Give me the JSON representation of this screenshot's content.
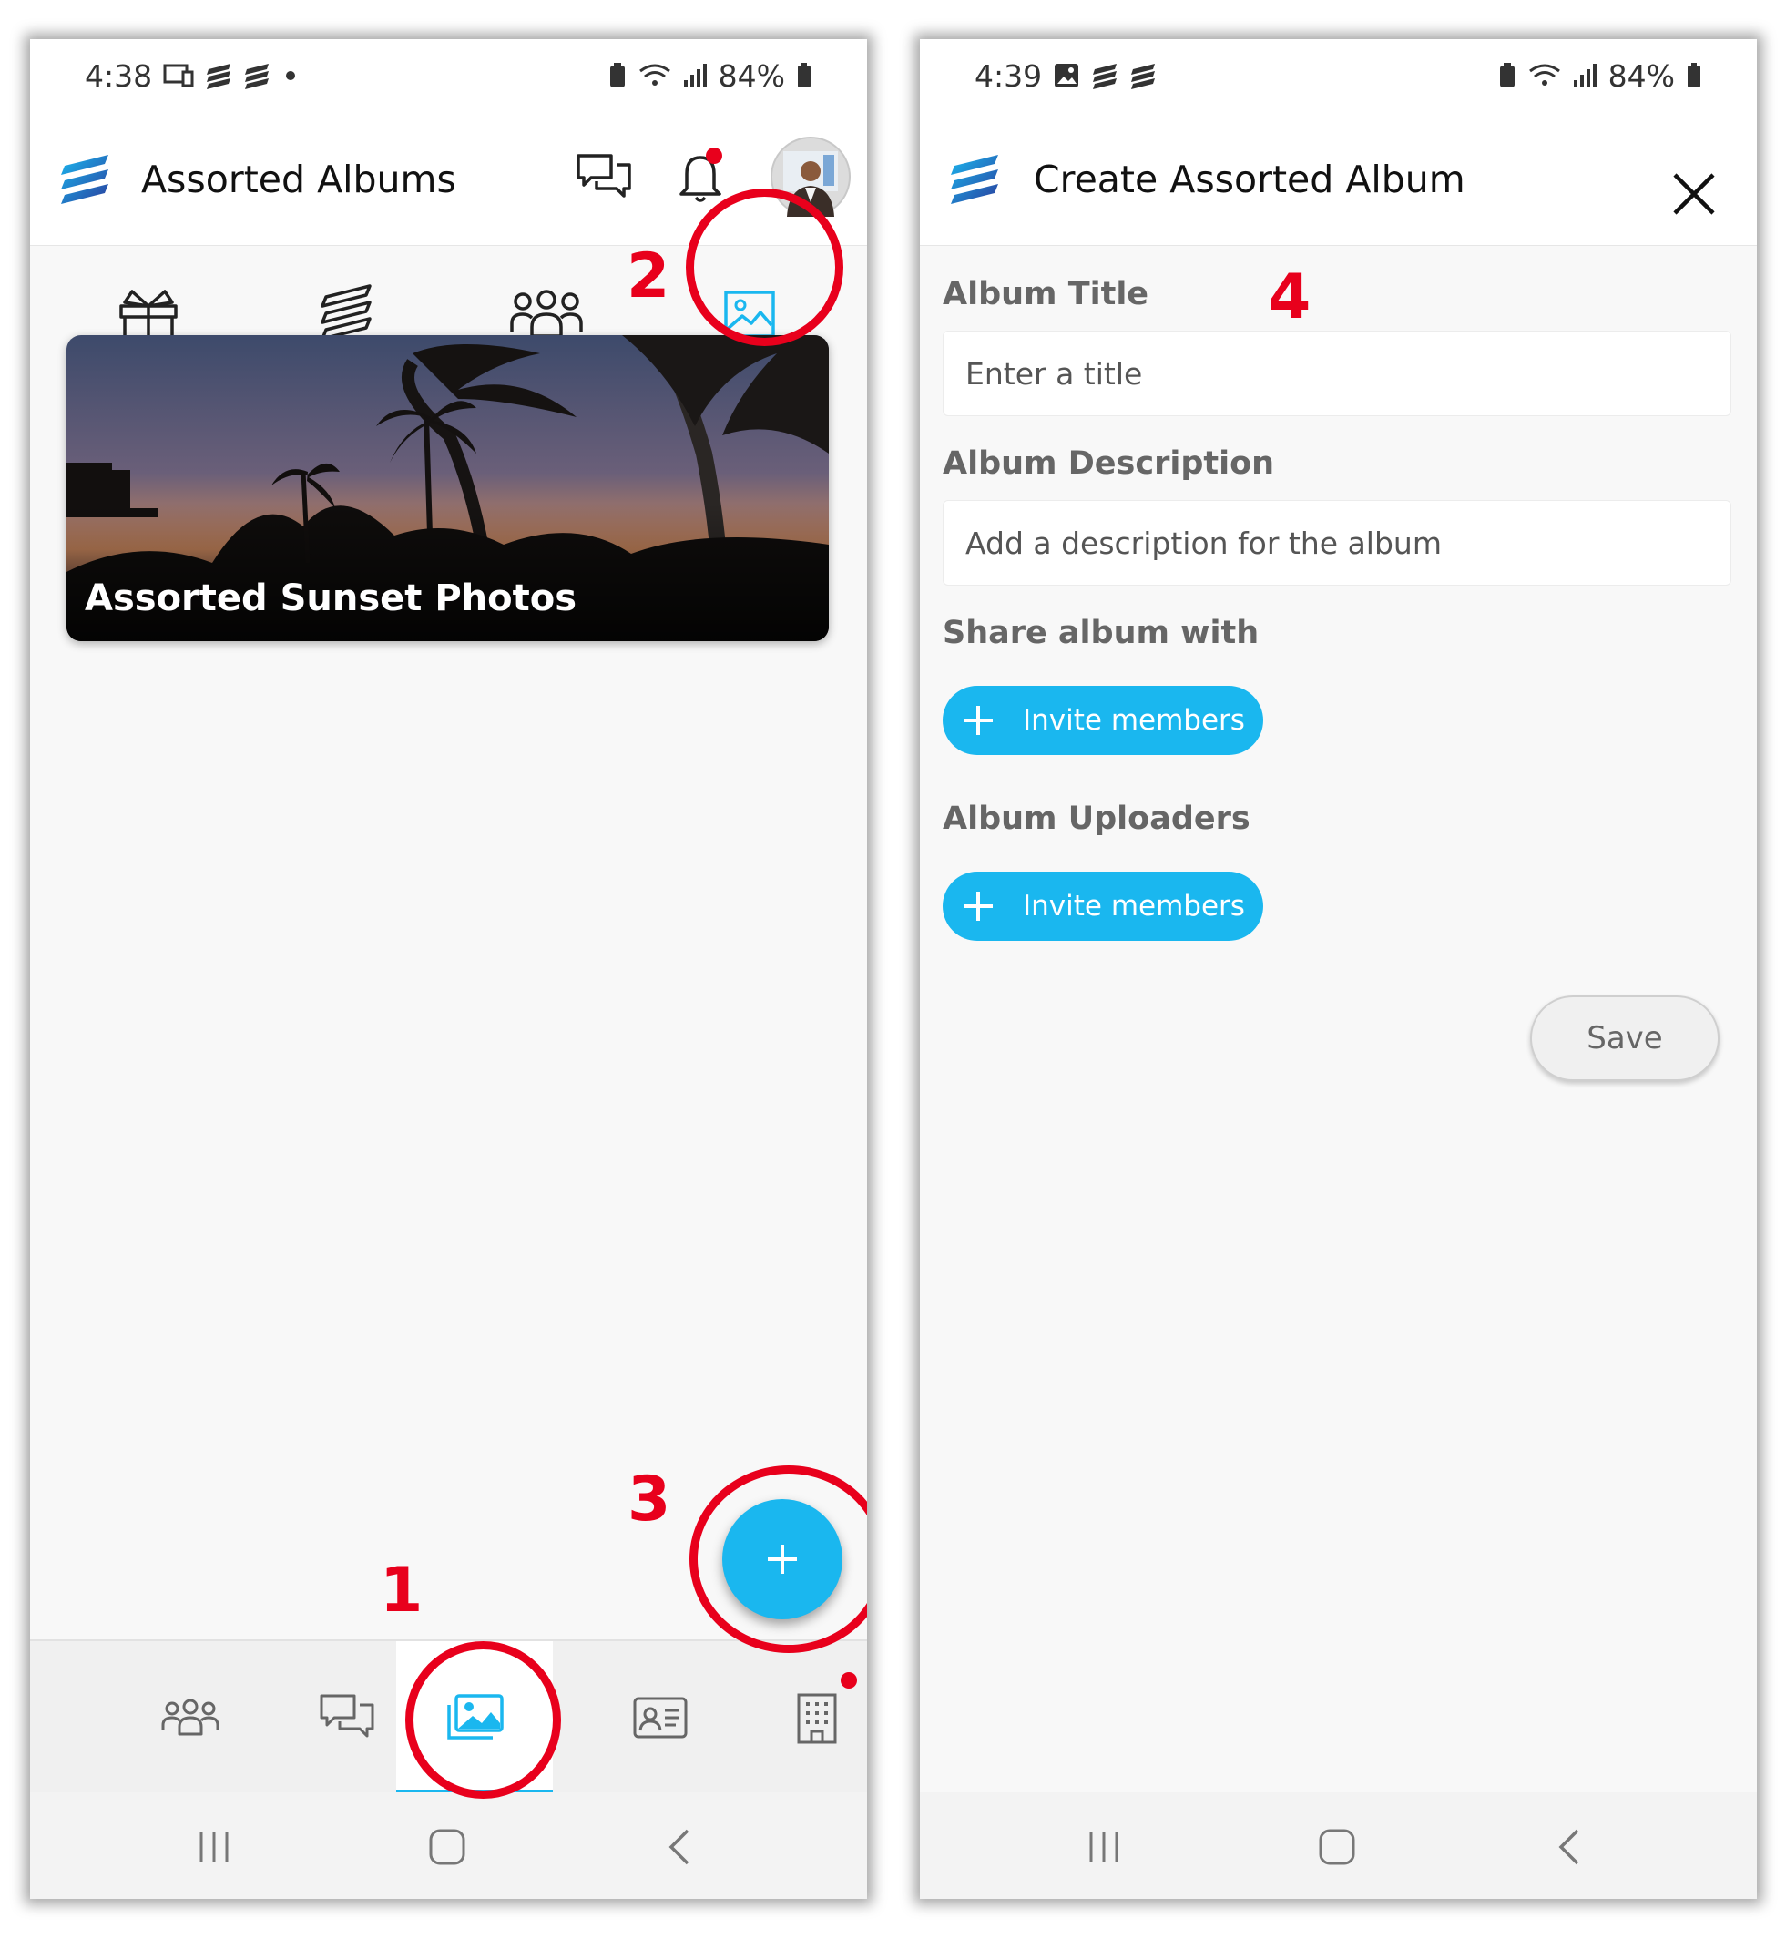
{
  "left_screen": {
    "status_bar": {
      "time": "4:38",
      "battery": "84%"
    },
    "header": {
      "title": "Assorted Albums"
    },
    "album_cards": [
      {
        "title": "Assorted Sunset Photos"
      }
    ],
    "annotations": [
      "1",
      "2",
      "3"
    ]
  },
  "right_screen": {
    "status_bar": {
      "time": "4:39",
      "battery": "84%"
    },
    "header": {
      "title": "Create Assorted Album"
    },
    "annotation": "4",
    "form": {
      "album_title_label": "Album Title",
      "album_title_placeholder": "Enter a title",
      "album_description_label": "Album Description",
      "album_description_placeholder": "Add a description for the album",
      "share_label": "Share album with",
      "share_invite_label": "Invite members",
      "uploaders_label": "Album Uploaders",
      "uploaders_invite_label": "Invite members",
      "save_label": "Save"
    }
  },
  "colors": {
    "accent": "#1ab7ef",
    "annotation": "#e8001c",
    "notification_dot": "#e8001c"
  },
  "icons": [
    "chat-bubbles-icon",
    "bell-icon",
    "gift-box-icon",
    "logo-icon",
    "people-icon",
    "image-icon",
    "plus-icon",
    "contact-card-icon",
    "building-icon",
    "close-icon"
  ]
}
